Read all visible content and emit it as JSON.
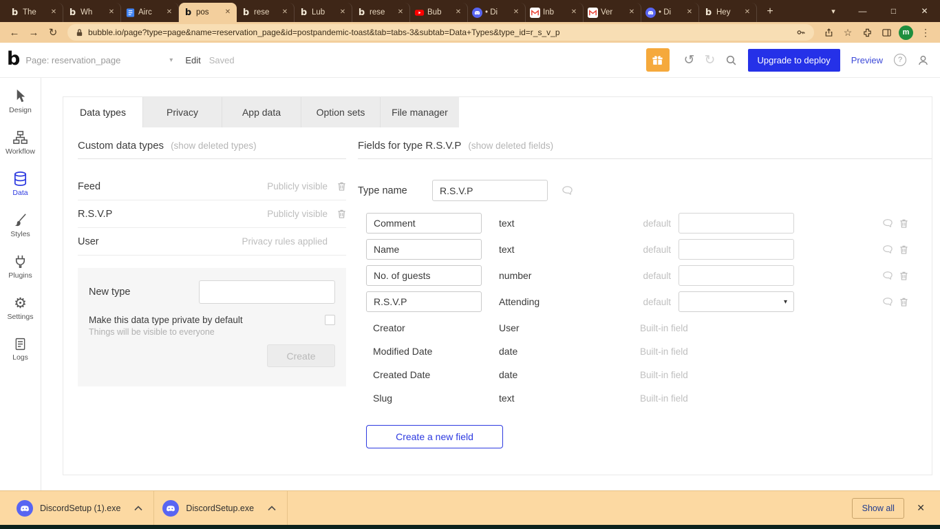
{
  "colors": {
    "chrome_frame": "#3e2617",
    "chrome_toolbar": "#f3cf9d",
    "accent_blue": "#2c39e0",
    "upgrade_blue": "#2531e8",
    "gift_orange": "#f5a93c",
    "downloads_bg": "#fcd9a2",
    "discord_blue": "#5865F2",
    "youtube_red": "#ff0000",
    "avatar_green": "#1e8e3e"
  },
  "icons": {
    "bubble_logo": "b",
    "close": "✕",
    "plus": "+",
    "caret_down": "▾",
    "minimize": "—",
    "maximize": "□",
    "back": "←",
    "forward": "→",
    "reload": "↻",
    "star": "☆",
    "menu": "⋮",
    "undo": "↺",
    "redo": "↻",
    "help": "?",
    "gear": "⚙",
    "select_caret": "▾"
  },
  "browser": {
    "tabs": [
      {
        "label": "The"
      },
      {
        "label": "Wh"
      },
      {
        "label": "Airc"
      },
      {
        "label": "pos"
      },
      {
        "label": "rese"
      },
      {
        "label": "Lub"
      },
      {
        "label": "rese"
      },
      {
        "label": "Bub"
      },
      {
        "label": "• Di"
      },
      {
        "label": "Inb"
      },
      {
        "label": "Ver"
      },
      {
        "label": "• Di"
      },
      {
        "label": "Hey"
      }
    ],
    "url": "bubble.io/page?type=page&name=reservation_page&id=postpandemic-toast&tab=tabs-3&subtab=Data+Types&type_id=r_s_v_p",
    "avatar": "m"
  },
  "editor": {
    "page_label": "Page: reservation_page",
    "edit": "Edit",
    "saved": "Saved",
    "upgrade": "Upgrade to deploy",
    "preview": "Preview"
  },
  "sidebar": {
    "items": [
      {
        "label": "Design"
      },
      {
        "label": "Workflow"
      },
      {
        "label": "Data"
      },
      {
        "label": "Styles"
      },
      {
        "label": "Plugins"
      },
      {
        "label": "Settings"
      },
      {
        "label": "Logs"
      }
    ]
  },
  "main": {
    "tabs": [
      {
        "label": "Data types"
      },
      {
        "label": "Privacy"
      },
      {
        "label": "App data"
      },
      {
        "label": "Option sets"
      },
      {
        "label": "File manager"
      }
    ]
  },
  "left_panel": {
    "title": "Custom data types",
    "deleted_link": "(show deleted types)",
    "types": [
      {
        "name": "Feed",
        "visibility": "Publicly visible"
      },
      {
        "name": "R.S.V.P",
        "visibility": "Publicly visible"
      },
      {
        "name": "User",
        "visibility": "Privacy rules applied"
      }
    ],
    "new_type_label": "New type",
    "private_label": "Make this data type private by default",
    "private_note": "Things will be visible to everyone",
    "create_label": "Create"
  },
  "right_panel": {
    "title": "Fields for type R.S.V.P",
    "deleted_link": "(show deleted fields)",
    "type_name_label": "Type name",
    "type_name_value": "R.S.V.P",
    "fields": [
      {
        "name": "Comment",
        "type": "text",
        "default_label": "default"
      },
      {
        "name": "Name",
        "type": "text",
        "default_label": "default"
      },
      {
        "name": "No. of guests",
        "type": "number",
        "default_label": "default"
      },
      {
        "name": "R.S.V.P",
        "type": "Attending",
        "default_label": "default"
      },
      {
        "name": "Creator",
        "type": "User",
        "builtin": "Built-in field"
      },
      {
        "name": "Modified Date",
        "type": "date",
        "builtin": "Built-in field"
      },
      {
        "name": "Created Date",
        "type": "date",
        "builtin": "Built-in field"
      },
      {
        "name": "Slug",
        "type": "text",
        "builtin": "Built-in field"
      }
    ],
    "create_field_label": "Create a new field"
  },
  "downloads": {
    "items": [
      {
        "name": "DiscordSetup (1).exe"
      },
      {
        "name": "DiscordSetup.exe"
      }
    ],
    "show_all": "Show all"
  }
}
